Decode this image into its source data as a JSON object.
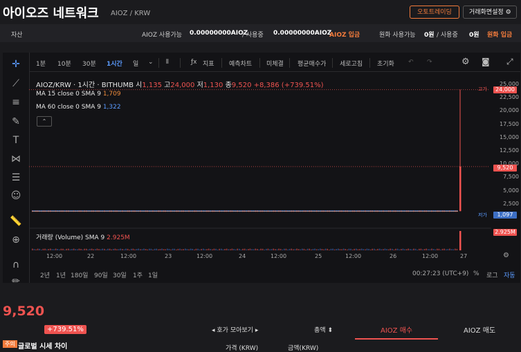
{
  "header": {
    "title": "아이오즈 네트워크",
    "pair": "AIOZ / KRW",
    "auto_trading_label": "오토트레이딩",
    "settings_label": "거래화면설정"
  },
  "balance": {
    "asset_label": "자산",
    "aioz_available_label": "AIOZ 사용가능",
    "aioz_available_value": "0.00000000AIOZ",
    "in_use_label": "/ 사용중",
    "aioz_in_use_value": "0.00000000AIOZ",
    "aioz_deposit_label": "AIOZ 입금",
    "krw_available_label": "원화 사용가능",
    "krw_available_value": "0원",
    "krw_in_use_label": "/ 사용중",
    "krw_in_use_value": "0원",
    "krw_deposit_label": "원화 입금"
  },
  "toolbar": {
    "intervals": [
      "1분",
      "10분",
      "30분",
      "1시간",
      "일"
    ],
    "active_interval": "1시간",
    "indicators_label": "지표",
    "forecast_label": "예측차트",
    "trades_label": "미체결",
    "avg_price_label": "평균매수가",
    "refresh_label": "세로고침",
    "reset_label": "초기화"
  },
  "legend": {
    "symbol": "AIOZ/KRW · 1시간 · BITHUMB",
    "open_label": "시",
    "open": "1,135",
    "high_label": "고",
    "high": "24,000",
    "low_label": "저",
    "low": "1,130",
    "close_label": "종",
    "close": "9,520",
    "change": "+8,386 (+739.51%)",
    "ma15_label": "MA 15 close 0 SMA 9",
    "ma15_value": "1,709",
    "ma60_label": "MA 60 close 0 SMA 9",
    "ma60_value": "1,322",
    "volume_label": "거래량 (Volume) SMA 9",
    "volume_value": "2.925M"
  },
  "axis": {
    "high_tag_label": "고가",
    "high_tag": "24,000",
    "last_tag": "9,520",
    "low_tag_label": "저가",
    "low_tag": "1,097",
    "volume_tag": "2.925M"
  },
  "chart_data": {
    "type": "candlestick",
    "y_ticks": [
      "25,000",
      "22,500",
      "20,000",
      "17,500",
      "15,000",
      "12,500",
      "10,000",
      "7,500",
      "5,000",
      "2,500"
    ],
    "ylim": [
      0,
      25000
    ],
    "x_ticks": [
      "12:00",
      "22",
      "12:00",
      "23",
      "12:00",
      "24",
      "12:00",
      "25",
      "12:00",
      "26",
      "12:00",
      "27"
    ],
    "base_price": 1135,
    "spike": {
      "open": 1135,
      "high": 24000,
      "low": 1130,
      "close": 9520
    },
    "volume_spike": 2925000
  },
  "bottom_bar": {
    "ranges": [
      "2년",
      "1년",
      "180일",
      "90일",
      "30일",
      "1주",
      "1일"
    ],
    "clock": "00:27:23 (UTC+9)",
    "percent_label": "%",
    "log_label": "로그",
    "auto_label": "자동"
  },
  "trade": {
    "price": "9,520",
    "change_pct": "+739.51%",
    "notice_badge": "주의",
    "notice_text": "글로벌 시세 차이",
    "orderbook_label": "호가 모아보기",
    "total_label": "총액",
    "buy_tab": "AIOZ 매수",
    "sell_tab": "AIOZ 매도",
    "price_col": "가격 (KRW)",
    "amount_col": "금액(KRW)"
  }
}
